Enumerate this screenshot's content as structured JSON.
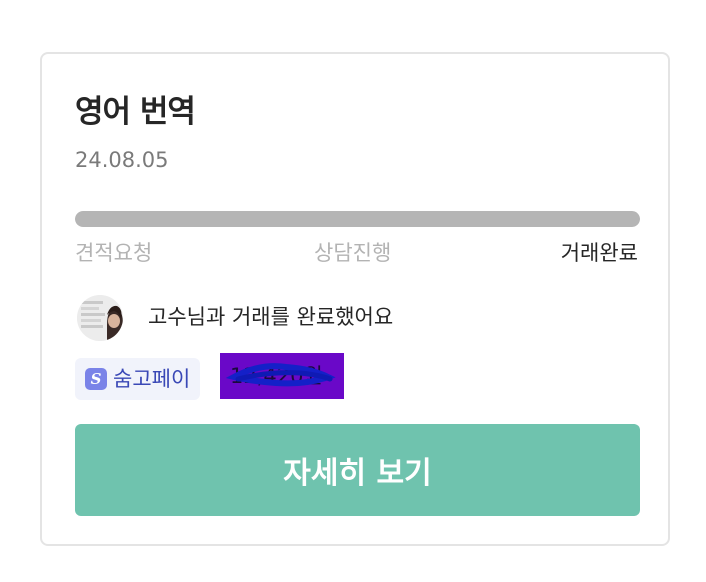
{
  "card": {
    "title": "영어 번역",
    "date": "24.08.05",
    "progress": {
      "fraction": 1.0,
      "steps": [
        {
          "label": "견적요청",
          "active": false
        },
        {
          "label": "상담진행",
          "active": false
        },
        {
          "label": "거래완료",
          "active": true
        }
      ]
    },
    "message": "고수님과 거래를 완료했어요",
    "pay": {
      "icon": "s-logo-icon",
      "label": "숨고페이"
    },
    "amount": "12,420원",
    "detail_button": "자세히 보기"
  },
  "colors": {
    "button": "#6fc3ae",
    "progress_fill": "#b5b5b5",
    "pay_icon": "#7a83e8",
    "pay_text": "#3a48b6",
    "redaction": "#6a08c8"
  }
}
